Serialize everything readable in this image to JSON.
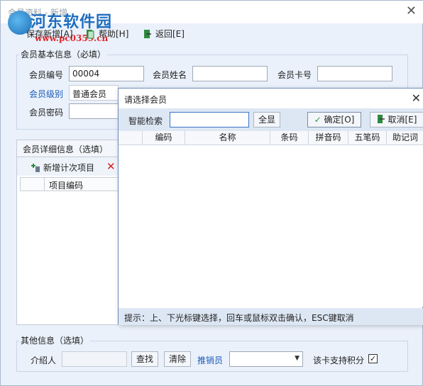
{
  "window": {
    "title": "会员资料 - 新增",
    "close": "✕"
  },
  "logo": {
    "main": "河东软件园",
    "sub": "www.pc0359.cn"
  },
  "toolbar": {
    "save_add": "保存新增[A]",
    "help": "帮助[H]",
    "back": "返回[E]"
  },
  "basic": {
    "group_label": "会员基本信息（必填）",
    "member_no_label": "会员编号",
    "member_no_value": "00004",
    "member_name_label": "会员姓名",
    "member_name_value": "",
    "card_no_label": "会员卡号",
    "card_no_value": "",
    "level_label": "会员级别",
    "level_value": "普通会员",
    "password_label": "会员密码",
    "password_value": ""
  },
  "detail": {
    "tab_label": "会员详细信息（选填）",
    "add_item": "新增计次项目",
    "col_item_code": "项目编码"
  },
  "other": {
    "group_label": "其他信息（选填）",
    "referrer_label": "介绍人",
    "referrer_value": "",
    "find_button": "查找",
    "clear_button": "清除",
    "promoter_label": "推销员",
    "promoter_value": "",
    "points_label": "该卡支持积分",
    "points_checked": true
  },
  "dialog": {
    "title": "请选择会员",
    "close": "✕",
    "search_label": "智能检索",
    "search_value": "",
    "show_all": "全显",
    "ok": "确定[O]",
    "cancel": "取消[E]",
    "columns": [
      "编码",
      "名称",
      "条码",
      "拼音码",
      "五笔码",
      "助记词"
    ],
    "status": "提示：上、下光标键选择，回车或鼠标双击确认，ESC键取消"
  },
  "colors": {
    "blue_label": "#1a5bb5",
    "accent": "#1f6dbf",
    "logo_red": "#e0262b"
  }
}
